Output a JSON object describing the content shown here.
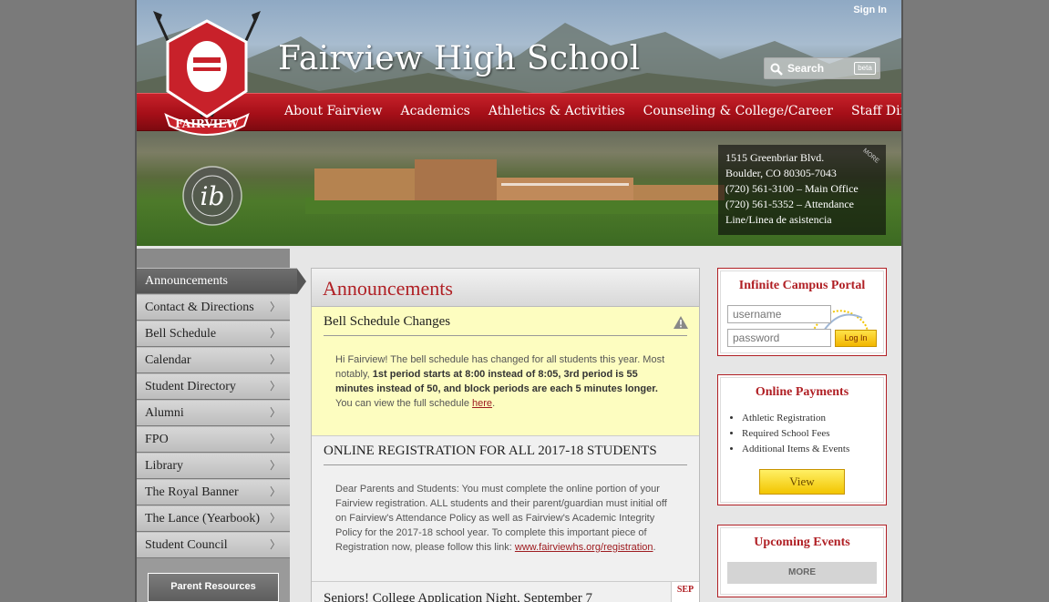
{
  "header": {
    "school_name": "Fairview High School",
    "sign_in": "Sign In",
    "search_label": "Search",
    "search_badge": "beta",
    "logo_text": "FAIRVIEW",
    "nav": [
      "About Fairview",
      "Academics",
      "Athletics & Activities",
      "Counseling & College/Career",
      "Staff Directory"
    ],
    "address": {
      "line1": "1515 Greenbriar Blvd.",
      "line2": "Boulder, CO 80305-7043",
      "line3": "(720) 561-3100  –  Main Office",
      "line4": "(720) 561-5352  –  Attendance",
      "line5": "Line/Linea de asistencia",
      "more": "MORE"
    },
    "colors": {
      "brand_red": "#b01f24",
      "nav_red": "#a50f18"
    }
  },
  "sidebar": {
    "items": [
      {
        "label": "Announcements",
        "active": true
      },
      {
        "label": "Contact & Directions"
      },
      {
        "label": "Bell Schedule"
      },
      {
        "label": "Calendar"
      },
      {
        "label": "Student Directory"
      },
      {
        "label": "Alumni"
      },
      {
        "label": "FPO"
      },
      {
        "label": "Library"
      },
      {
        "label": "The Royal Banner"
      },
      {
        "label": "The Lance (Yearbook)"
      },
      {
        "label": "Student Council"
      }
    ],
    "parent_resources": "Parent Resources"
  },
  "main": {
    "title": "Announcements",
    "posts": [
      {
        "title": "Bell Schedule Changes",
        "body_pre": "Hi Fairview! The bell schedule has changed for all students this year. Most notably, ",
        "body_bold": "1st period starts at 8:00 instead of 8:05, 3rd period is 55 minutes instead of 50, and block periods are each 5 minutes longer.",
        "body_post": " You can view the full schedule ",
        "link": "here",
        "end": "."
      },
      {
        "title": "ONLINE REGISTRATION FOR ALL 2017-18 STUDENTS",
        "body": "Dear Parents and Students: You must complete the online portion of your Fairview registration. ALL students and their parent/guardian must initial off on Fairview's Attendance Policy as well as Fairview's Academic Integrity Policy for the 2017-18 school year. To complete this important piece of Registration now, please follow this link: ",
        "link": "www.fairviewhs.org/registration",
        "end": "."
      },
      {
        "title": "Seniors! College Application Night, September 7",
        "date_month": "SEP"
      }
    ]
  },
  "widgets": {
    "infinite_campus": {
      "title": "Infinite Campus Portal",
      "username_placeholder": "username",
      "password_placeholder": "password",
      "login": "Log In"
    },
    "payments": {
      "title": "Online Payments",
      "items": [
        "Athletic Registration",
        "Required School Fees",
        "Additional Items & Events"
      ],
      "button": "View"
    },
    "events": {
      "title": "Upcoming Events",
      "button": "MORE"
    }
  }
}
